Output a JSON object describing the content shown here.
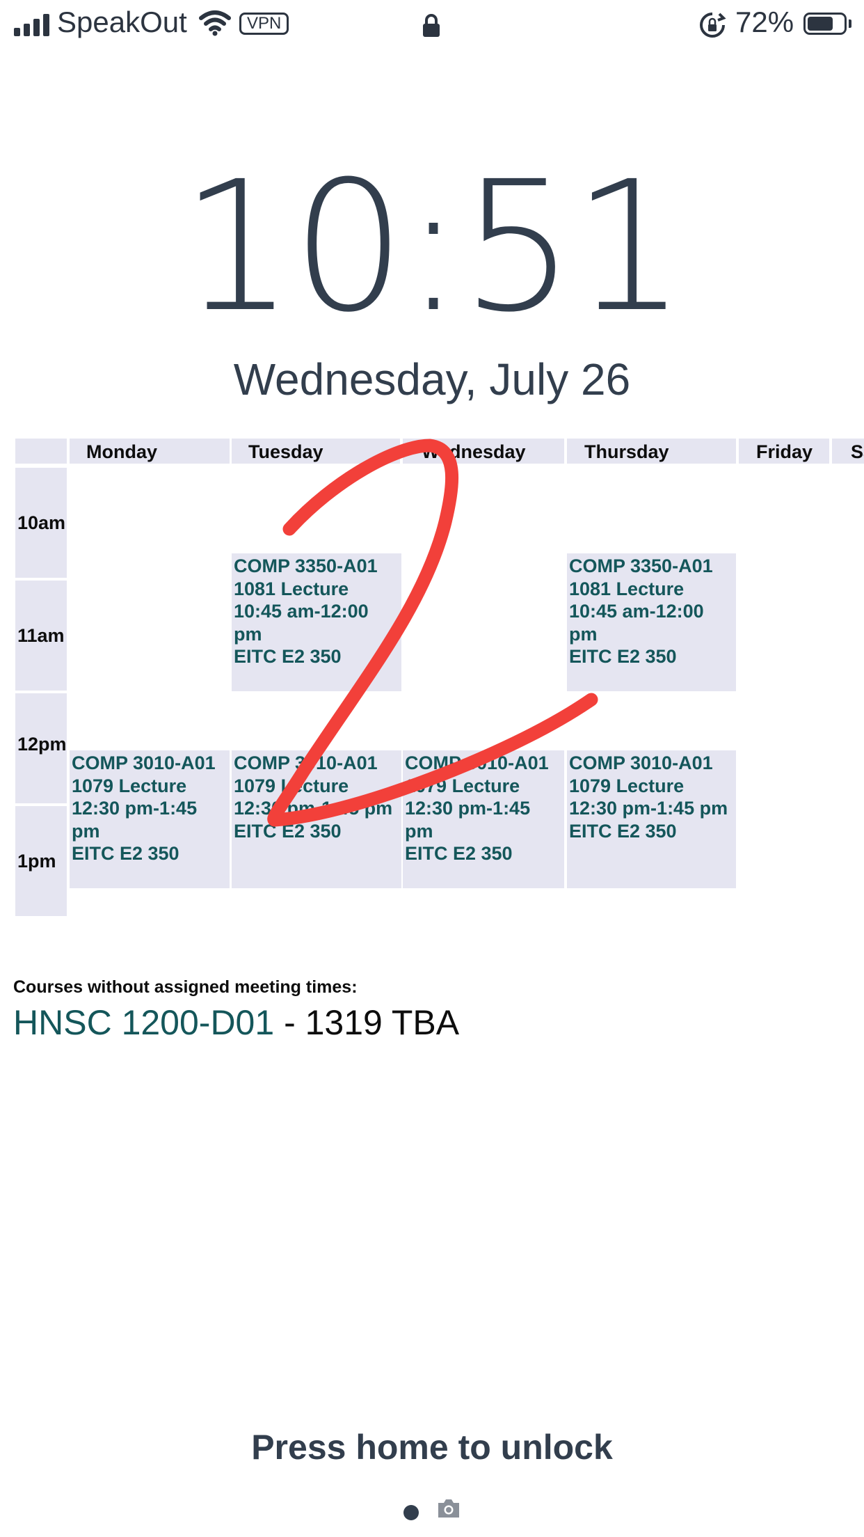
{
  "status_bar": {
    "carrier": "SpeakOut",
    "vpn": "VPN",
    "battery_percent": "72%",
    "battery_level": 0.72
  },
  "lock_screen": {
    "time": "10:51",
    "date": "Wednesday, July 26",
    "unlock_hint": "Press home to unlock"
  },
  "schedule": {
    "days": [
      "Monday",
      "Tuesday",
      "Wednesday",
      "Thursday",
      "Friday",
      "Sa"
    ],
    "times": [
      "10am",
      "11am",
      "12pm",
      "1pm"
    ],
    "courses": {
      "tue_3350": [
        "COMP 3350-A01",
        "1081 Lecture",
        "10:45 am-12:00",
        "pm",
        "EITC E2 350"
      ],
      "thu_3350": [
        "COMP 3350-A01",
        "1081 Lecture",
        "10:45 am-12:00",
        "pm",
        "EITC E2 350"
      ],
      "mon_3010": [
        "COMP 3010-A01",
        "1079 Lecture",
        "12:30 pm-1:45",
        "pm",
        "EITC E2 350"
      ],
      "tue_3010": [
        "COMP 3010-A01",
        "1079 Lecture",
        "12:30 pm-1:45 pm",
        "EITC E2 350"
      ],
      "wed_3010": [
        "COMP 3010-A01",
        "1079 Lecture",
        "12:30 pm-1:45",
        "pm",
        "EITC E2 350"
      ],
      "thu_3010": [
        "COMP 3010-A01",
        "1079 Lecture",
        "12:30 pm-1:45 pm",
        "EITC E2 350"
      ]
    }
  },
  "unscheduled": {
    "title": "Courses without assigned meeting times:",
    "course_code": "HNSC 1200-D01",
    "course_rest": " - 1319 TBA"
  },
  "colors": {
    "course_text": "#14565a",
    "cell_bg": "#e5e5f1",
    "scribble": "#f2403a"
  }
}
